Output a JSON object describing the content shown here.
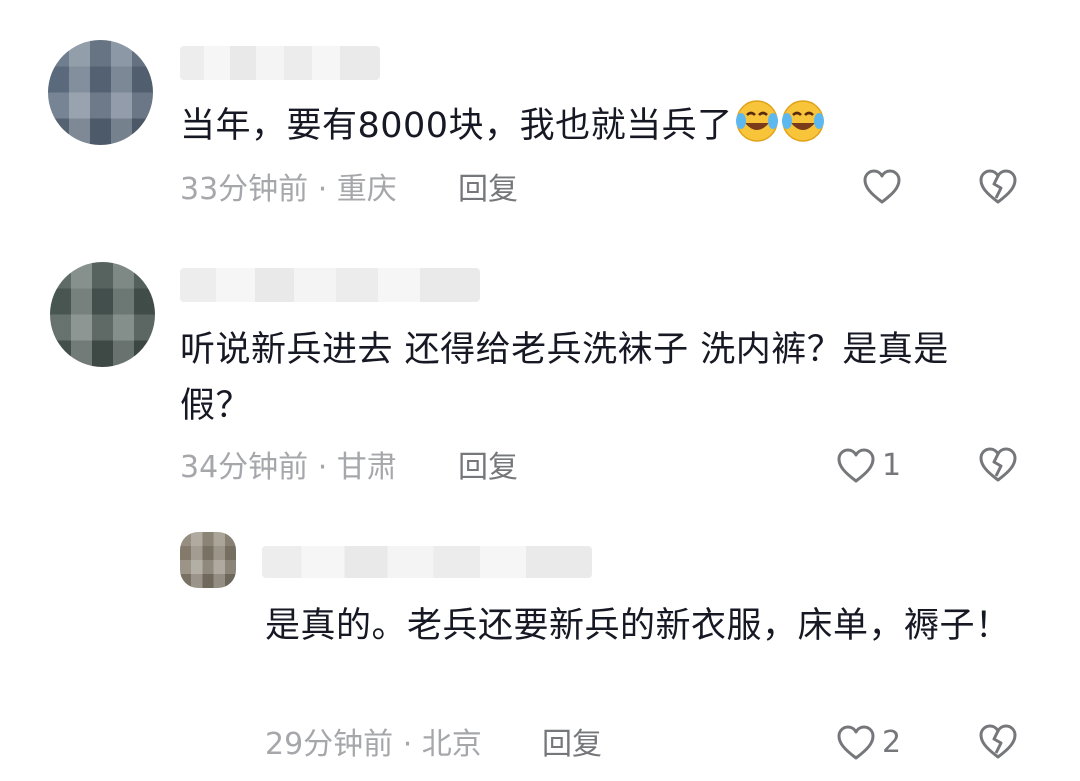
{
  "comments": [
    {
      "text": "当年，要有8000块，我也就当兵了",
      "emoji": [
        "crying-laughing-emoji",
        "crying-laughing-emoji"
      ],
      "meta": "33分钟前 · 重庆",
      "reply_label": "回复",
      "like_count": ""
    },
    {
      "text": "听说新兵进去 还得给老兵洗袜子 洗内裤？是真是假？",
      "meta": "34分钟前 · 甘肃",
      "reply_label": "回复",
      "like_count": "1"
    },
    {
      "text": "是真的。老兵还要新兵的新衣服，床单，褥子！",
      "meta": "29分钟前 · 北京",
      "reply_label": "回复",
      "like_count": "2"
    }
  ],
  "colors": {
    "text": "#161823",
    "meta": "#a6a7ab",
    "icon": "#76777b",
    "background": "#ffffff"
  }
}
